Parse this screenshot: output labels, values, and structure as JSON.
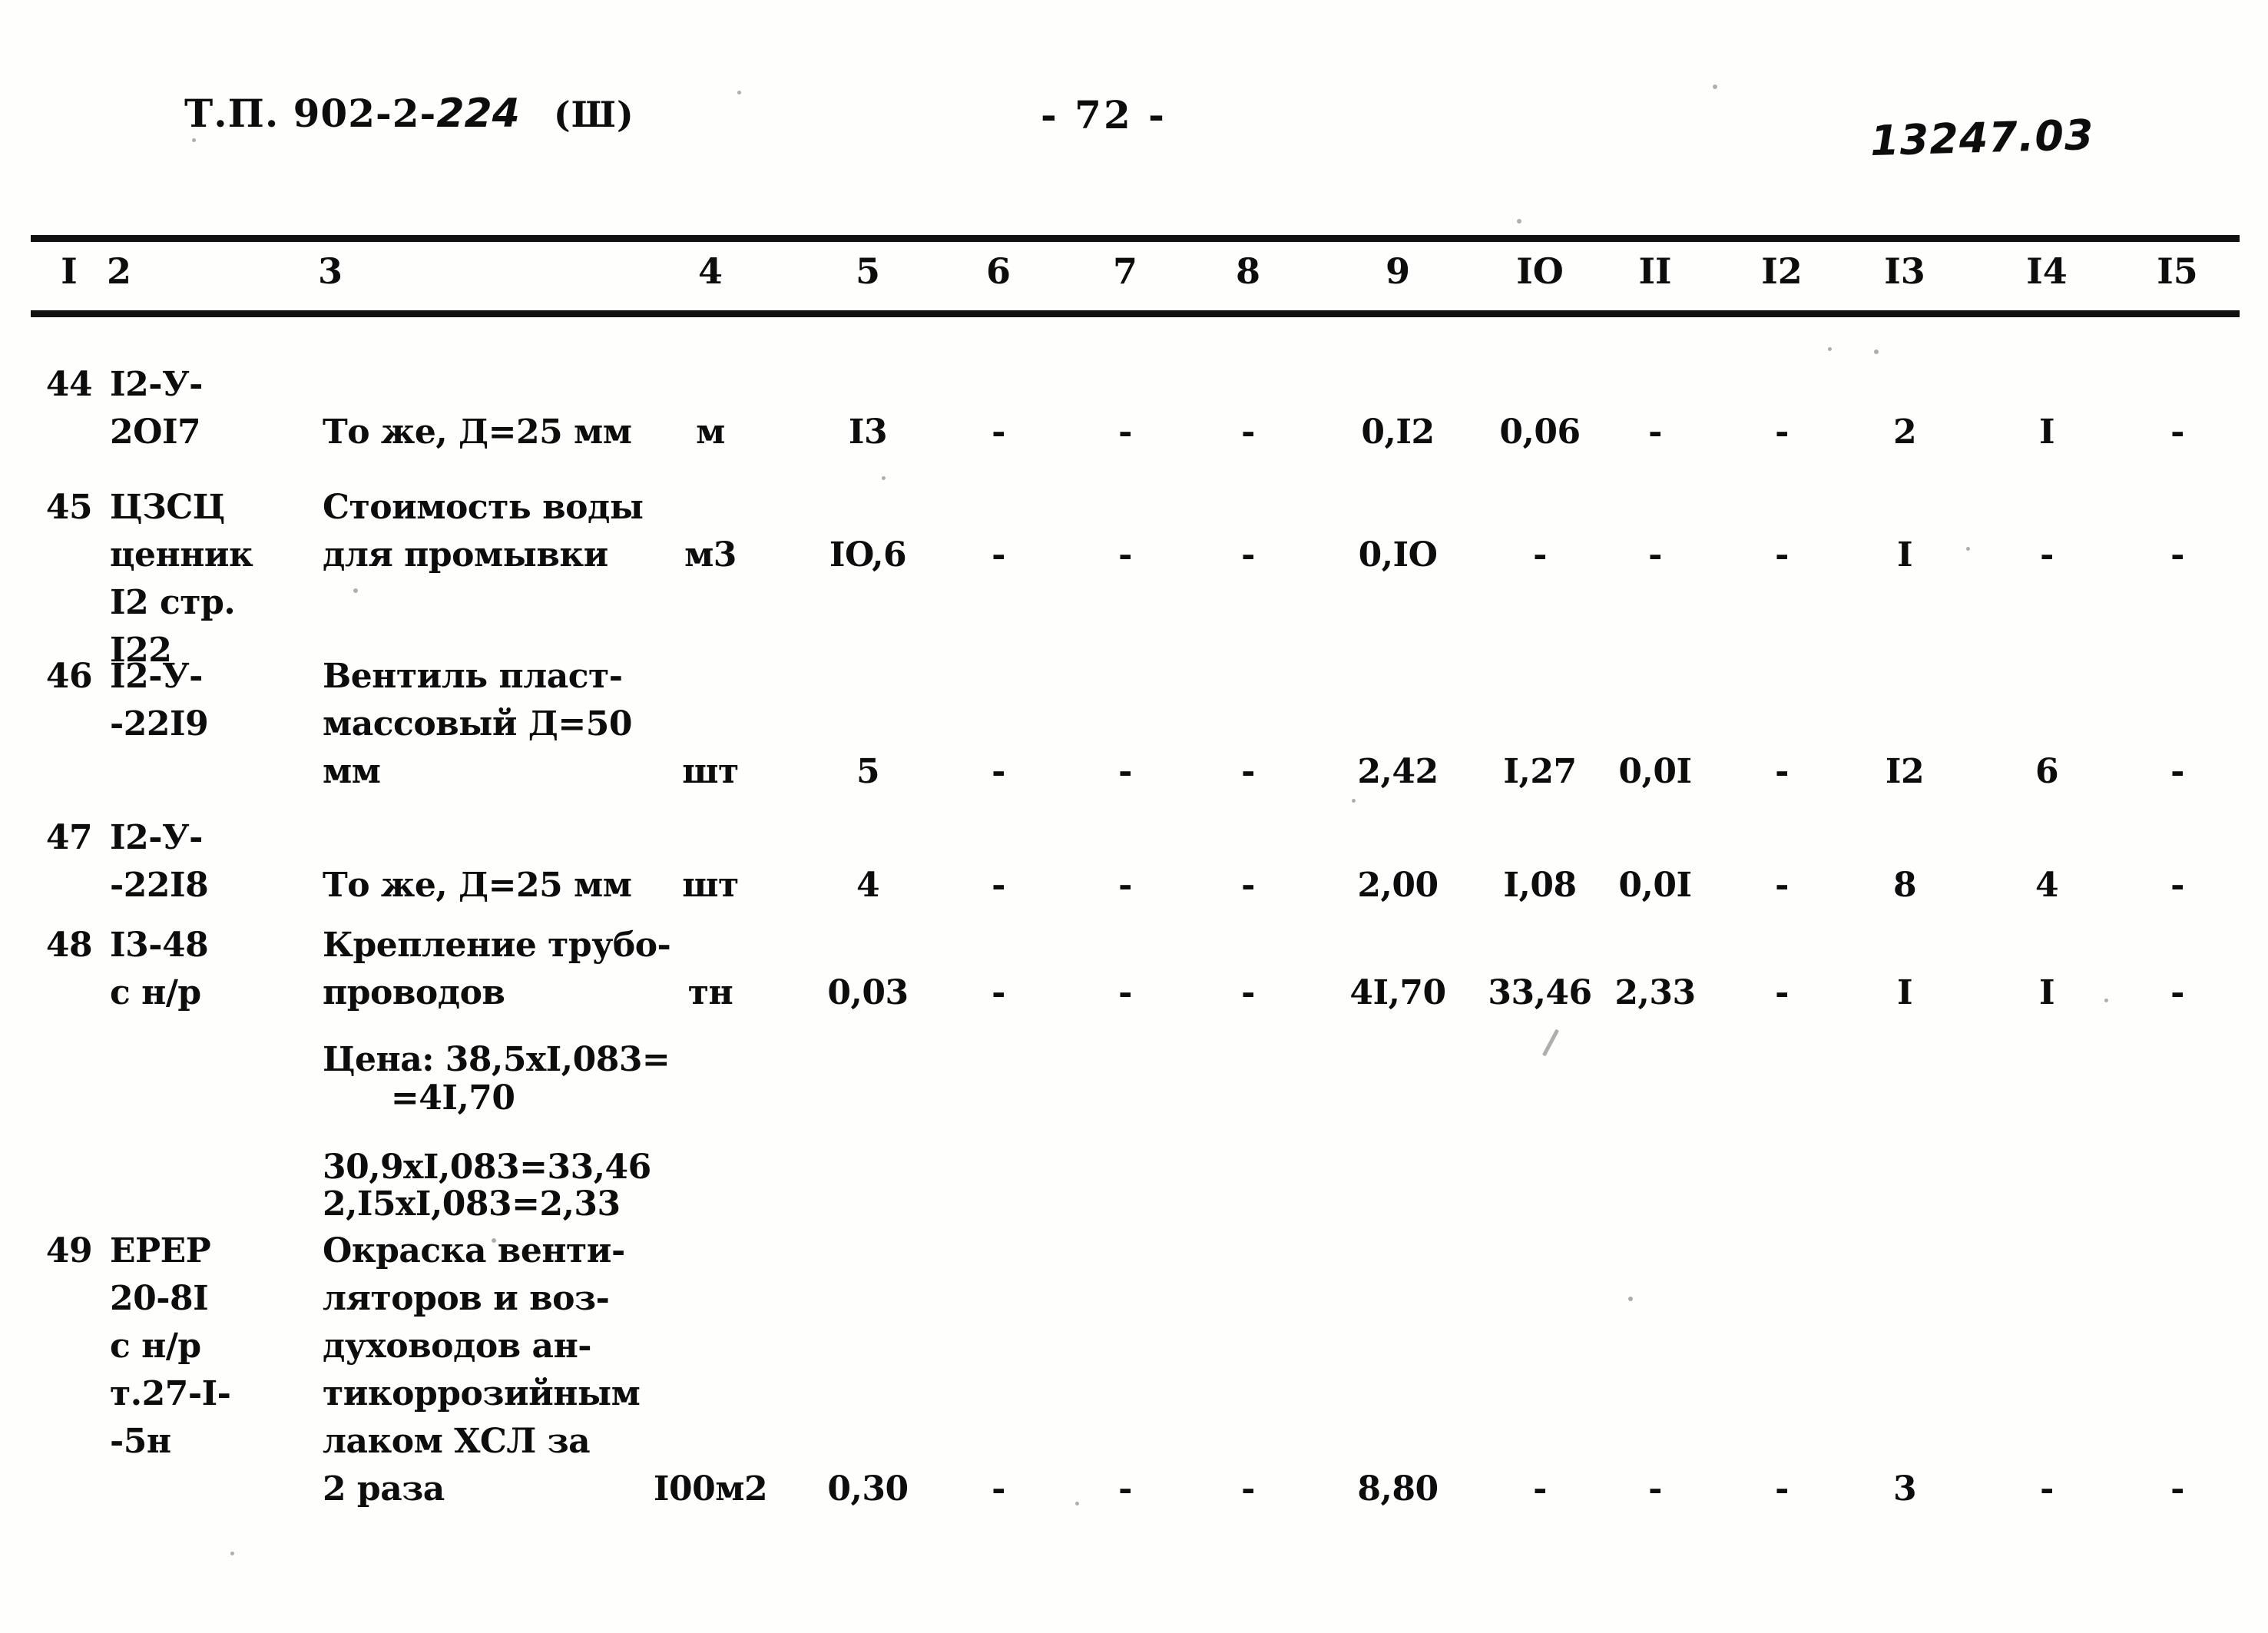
{
  "header": {
    "doc_code_prefix": "Т.П. 902-2-",
    "doc_code_hand": "224",
    "volume": "(Ш)",
    "page_number": "- 72 -",
    "archive_code": "13247.03"
  },
  "table": {
    "column_headers": [
      "I",
      "2",
      "3",
      "4",
      "5",
      "6",
      "7",
      "8",
      "9",
      "IO",
      "II",
      "I2",
      "I3",
      "I4",
      "I5"
    ],
    "rows": [
      {
        "no": "44",
        "code": "I2-У-\n2OI7",
        "name": "То же, Д=25 мм",
        "unit": "м",
        "qty": "I3",
        "c6": "-",
        "c7": "-",
        "c8": "-",
        "c9": "0,I2",
        "c10": "0,06",
        "c11": "-",
        "c12": "-",
        "c13": "2",
        "c14": "I",
        "c15": "-"
      },
      {
        "no": "45",
        "code": "ЦЗСЦ\nценник\nI2 стр.\nI22",
        "name": "Стоимость воды\nдля промывки",
        "unit": "м3",
        "qty": "IO,6",
        "c6": "-",
        "c7": "-",
        "c8": "-",
        "c9": "0,IO",
        "c10": "-",
        "c11": "-",
        "c12": "-",
        "c13": "I",
        "c14": "-",
        "c15": "-"
      },
      {
        "no": "46",
        "code": "I2-У-\n-22I9",
        "name": "Вентиль пласт-\nмассовый Д=50\nмм",
        "unit": "шт",
        "qty": "5",
        "c6": "-",
        "c7": "-",
        "c8": "-",
        "c9": "2,42",
        "c10": "I,27",
        "c11": "0,0I",
        "c12": "-",
        "c13": "I2",
        "c14": "6",
        "c15": "-"
      },
      {
        "no": "47",
        "code": "I2-У-\n-22I8",
        "name": "То же, Д=25 мм",
        "unit": "шт",
        "qty": "4",
        "c6": "-",
        "c7": "-",
        "c8": "-",
        "c9": "2,00",
        "c10": "I,08",
        "c11": "0,0I",
        "c12": "-",
        "c13": "8",
        "c14": "4",
        "c15": "-"
      },
      {
        "no": "48",
        "code": "I3-48\nс н/р",
        "name": "Крепление трубо-\nпроводов",
        "unit": "тн",
        "qty": "0,03",
        "c6": "-",
        "c7": "-",
        "c8": "-",
        "c9": "4I,70",
        "c10": "33,46",
        "c11": "2,33",
        "c12": "-",
        "c13": "I",
        "c14": "I",
        "c15": "-"
      },
      {
        "no": "49",
        "code": "ЕРЕР\n20-8I\nс н/р\nт.27-I-\n-5н",
        "name": "Окраска венти-\nляторов и воз-\nдуховодов ан-\nтикоррозийным\nлаком ХСЛ за\n2 раза",
        "unit": "I00м2",
        "qty": "0,30",
        "c6": "-",
        "c7": "-",
        "c8": "-",
        "c9": "8,80",
        "c10": "-",
        "c11": "-",
        "c12": "-",
        "c13": "3",
        "c14": "-",
        "c15": "-"
      }
    ],
    "notes": [
      "Цена: 38,5xI,083=",
      "      =4I,70",
      "30,9xI,083=33,46",
      "2,I5xI,083=2,33"
    ]
  }
}
